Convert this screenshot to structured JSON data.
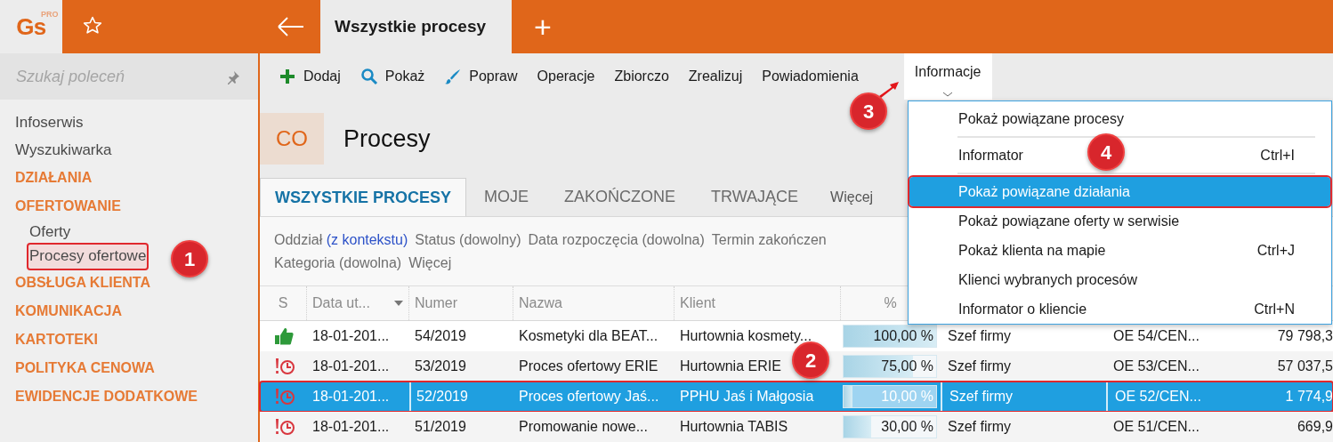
{
  "app": {
    "logo": "Gs",
    "logo_badge": "PRO"
  },
  "tabs": [
    {
      "label": "Wszystkie procesy",
      "selected": true
    }
  ],
  "new_tab": "+",
  "sidebar": {
    "search": {
      "placeholder": "Szukaj poleceń"
    },
    "items": [
      {
        "kind": "link",
        "label": "Infoserwis"
      },
      {
        "kind": "link",
        "label": "Wyszukiwarka"
      },
      {
        "kind": "section",
        "label": "DZIAŁANIA"
      },
      {
        "kind": "section",
        "label": "OFERTOWANIE",
        "children": [
          {
            "label": "Oferty",
            "selected": false
          },
          {
            "label": "Procesy ofertowe",
            "selected": true
          }
        ]
      },
      {
        "kind": "section",
        "label": "OBSŁUGA KLIENTA"
      },
      {
        "kind": "section",
        "label": "KOMUNIKACJA"
      },
      {
        "kind": "section",
        "label": "KARTOTEKI"
      },
      {
        "kind": "section",
        "label": "POLITYKA CENOWA"
      },
      {
        "kind": "section",
        "label": "EWIDENCJE DODATKOWE"
      }
    ]
  },
  "toolbar": [
    {
      "label": "Dodaj",
      "selected": false
    },
    {
      "label": "Pokaż",
      "selected": false
    },
    {
      "label": "Popraw",
      "selected": false
    },
    {
      "label": "Operacje",
      "selected": false
    },
    {
      "label": "Zbiorczo",
      "selected": false
    },
    {
      "label": "Zrealizuj",
      "selected": false
    },
    {
      "label": "Powiadomienia",
      "selected": false
    },
    {
      "label": "Informacje",
      "selected": true
    }
  ],
  "module": {
    "badge": "CO",
    "title": "Procesy"
  },
  "views": [
    {
      "label": "WSZYSTKIE PROCESY",
      "selected": true
    },
    {
      "label": "MOJE",
      "selected": false
    },
    {
      "label": "ZAKOŃCZONE",
      "selected": false
    },
    {
      "label": "TRWAJĄCE",
      "selected": false
    }
  ],
  "views_more": "Więcej",
  "filters": [
    [
      {
        "label": "Oddział",
        "link": "(z kontekstu)"
      },
      {
        "label": "Status (dowolny)"
      },
      {
        "label": "Data rozpoczęcia (dowolna)"
      },
      {
        "label": "Termin zakończen"
      }
    ],
    [
      {
        "label": "Kategoria (dowolna)"
      },
      {
        "label": "Więcej"
      }
    ]
  ],
  "table": {
    "columns": [
      {
        "label": "S"
      },
      {
        "label": "Data ut...",
        "sorted": true
      },
      {
        "label": "Numer"
      },
      {
        "label": "Nazwa"
      },
      {
        "label": "Klient"
      },
      {
        "label": "%"
      }
    ],
    "rows": [
      {
        "kind": "done",
        "selected": false,
        "date": "18-01-201...",
        "number": "54/2019",
        "name": "Kosmetyki dla BEAT...",
        "client": "Hurtownia kosmety...",
        "level": 1,
        "percent": "100,00 %",
        "owner": "Szef firmy",
        "offer": "OE 54/CEN...",
        "amount": "79 798,3"
      },
      {
        "kind": "late",
        "selected": false,
        "date": "18-01-201...",
        "number": "53/2019",
        "name": "Proces ofertowy ERIE",
        "client": "Hurtownia ERIE",
        "level": 0.75,
        "percent": "75,00 %",
        "owner": "Szef firmy",
        "offer": "OE 53/CEN...",
        "amount": "57 037,5"
      },
      {
        "kind": "late",
        "selected": true,
        "date": "18-01-201...",
        "number": "52/2019",
        "name": "Proces ofertowy Jaś...",
        "client": "PPHU Jaś i Małgosia",
        "level": 0.1,
        "percent": "10,00 %",
        "owner": "Szef firmy",
        "offer": "OE 52/CEN...",
        "amount": "1 774,9"
      },
      {
        "kind": "late",
        "selected": false,
        "date": "18-01-201...",
        "number": "51/2019",
        "name": "Promowanie nowe...",
        "client": "Hurtownia TABIS",
        "level": 0.3,
        "percent": "30,00 %",
        "owner": "Szef firmy",
        "offer": "OE 51/CEN...",
        "amount": "669,9"
      }
    ]
  },
  "menu": {
    "items": [
      {
        "label": "Pokaż powiązane procesy",
        "selected": false,
        "separator_after": true
      },
      {
        "label": "Informator",
        "shortcut": "Ctrl+I",
        "selected": false,
        "separator_after": true
      },
      {
        "label": "Pokaż powiązane działania",
        "selected": true
      },
      {
        "label": "Pokaż powiązane oferty w serwisie",
        "selected": false
      },
      {
        "label": "Pokaż klienta na mapie",
        "shortcut": "Ctrl+J",
        "selected": false
      },
      {
        "label": "Klienci wybranych procesów",
        "selected": false
      },
      {
        "label": "Informator o kliencie",
        "shortcut": "Ctrl+N",
        "selected": false
      }
    ]
  },
  "callouts": [
    {
      "number": "1"
    },
    {
      "number": "2"
    },
    {
      "number": "3",
      "arrow": true
    },
    {
      "number": "4"
    }
  ]
}
